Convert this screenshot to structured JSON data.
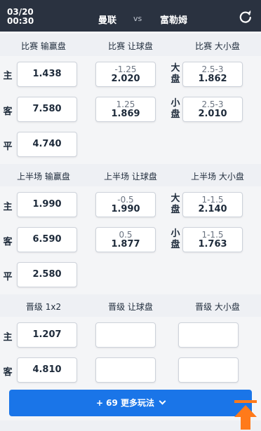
{
  "header": {
    "date": "03/20",
    "time": "00:30",
    "home_team": "曼联",
    "vs": "vs",
    "away_team": "富勒姆",
    "refresh_icon": "refresh-icon"
  },
  "sections": [
    {
      "headers": [
        "比赛 输赢盘",
        "比赛 让球盘",
        "比赛 大小盘"
      ],
      "moneyline": [
        {
          "label": "主",
          "odd": "1.438"
        },
        {
          "label": "客",
          "odd": "7.580"
        },
        {
          "label": "平",
          "odd": "4.740"
        }
      ],
      "handicap": [
        {
          "line": "-1.25",
          "odd": "2.020"
        },
        {
          "line": "1.25",
          "odd": "1.869"
        }
      ],
      "totals": [
        {
          "label": "大盘",
          "line": "2.5-3",
          "odd": "1.862"
        },
        {
          "label": "小盘",
          "line": "2.5-3",
          "odd": "2.010"
        }
      ]
    },
    {
      "headers": [
        "上半场 输赢盘",
        "上半场 让球盘",
        "上半场 大小盘"
      ],
      "moneyline": [
        {
          "label": "主",
          "odd": "1.990"
        },
        {
          "label": "客",
          "odd": "6.590"
        },
        {
          "label": "平",
          "odd": "2.580"
        }
      ],
      "handicap": [
        {
          "line": "-0.5",
          "odd": "1.990"
        },
        {
          "line": "0.5",
          "odd": "1.877"
        }
      ],
      "totals": [
        {
          "label": "大盘",
          "line": "1-1.5",
          "odd": "2.140"
        },
        {
          "label": "小盘",
          "line": "1-1.5",
          "odd": "1.763"
        }
      ]
    },
    {
      "headers": [
        "晋级 1x2",
        "晋级 让球盘",
        "晋级 大小盘"
      ],
      "moneyline": [
        {
          "label": "主",
          "odd": "1.207"
        },
        {
          "label": "客",
          "odd": "4.810"
        }
      ]
    }
  ],
  "more_button": {
    "label": "+ 69 更多玩法"
  },
  "colors": {
    "topbar": "#2a3240",
    "accent": "#1a75e8",
    "scroll_top": "#ff7a1a"
  }
}
